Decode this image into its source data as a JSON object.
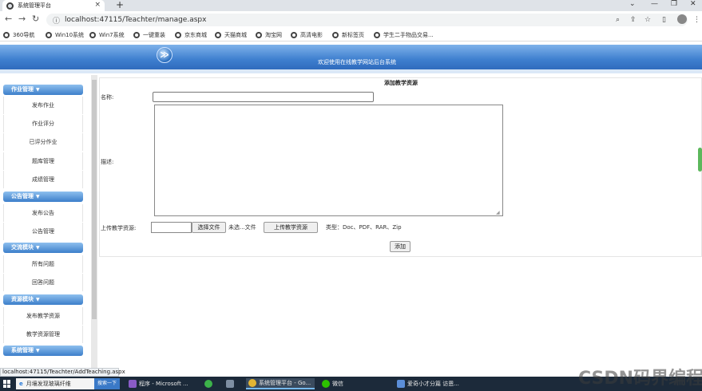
{
  "browser": {
    "tab_title": "系统管理平台",
    "new_tab_icon": "plus-icon",
    "url": "localhost:47115/Teachter/manage.aspx",
    "bookmarks": [
      "360导航",
      "Win10系统",
      "Win7系统",
      "一键重装",
      "京东商城",
      "天猫商城",
      "淘宝网",
      "高清电影",
      "新标签页",
      "学生二手物品交易..."
    ]
  },
  "header": {
    "logo_glyph": "≫",
    "welcome": "欢迎使用在线教学网站后台系统"
  },
  "sidebar": {
    "sections": [
      {
        "label": "作业管理",
        "items": [
          "发布作业",
          "作业评分",
          "已评分作业",
          "题库管理",
          "成绩管理"
        ]
      },
      {
        "label": "公告管理",
        "items": [
          "发布公告",
          "公告管理"
        ]
      },
      {
        "label": "交流模块",
        "items": [
          "所有问题",
          "回答问题"
        ]
      },
      {
        "label": "资源模块",
        "items": [
          "发布教学资源",
          "教学资源管理"
        ]
      },
      {
        "label": "系统管理",
        "items": []
      }
    ]
  },
  "form": {
    "title": "添加教学资源",
    "name_label": "名称:",
    "name_value": "",
    "desc_label": "描述:",
    "desc_value": "",
    "upload_label": "上传教学资源:",
    "choose_file": "选择文件",
    "no_file": "未选...文件",
    "upload_button": "上传教学资源",
    "types_text": "类型：Doc、PDF、RAR、Zip",
    "add_button": "添加"
  },
  "status_url": "localhost:47115/Teachter/AddTeaching.aspx",
  "taskbar": {
    "search_text": "月壤发现玻璃纤维",
    "search_button": "搜索一下",
    "apps": [
      "程序 - Microsoft ...",
      "系统管理平台 - Go...",
      "微信",
      "爱奇小才分篇 访恩..."
    ]
  },
  "watermark": "CSDN码界编程网",
  "colors": {
    "banner": "#3e7fcf",
    "section": "#3c7fca",
    "taskbar": "#1c2a3a"
  }
}
